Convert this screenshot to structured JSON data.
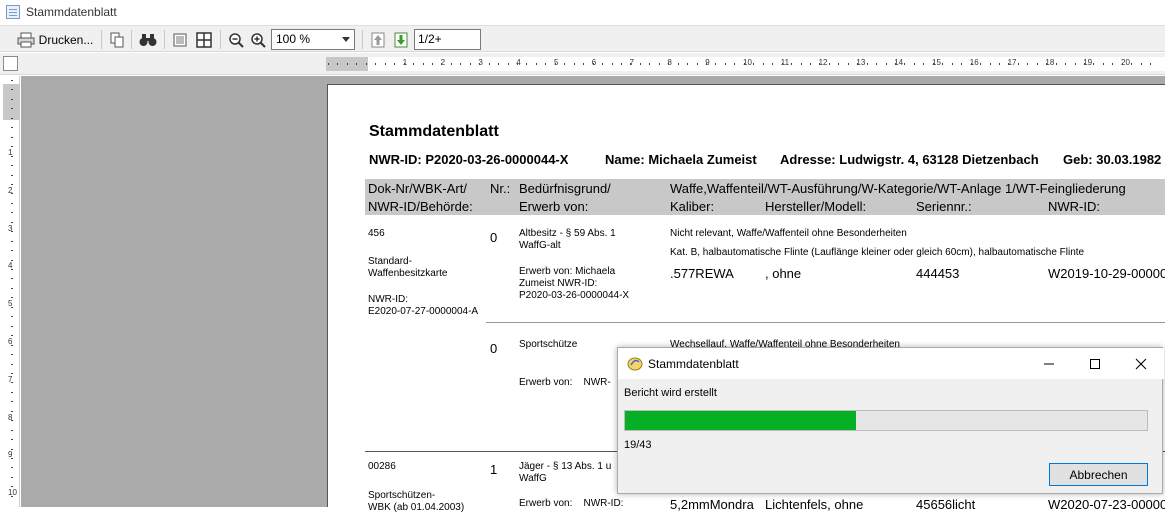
{
  "window": {
    "title": "Stammdatenblatt"
  },
  "toolbar": {
    "print_label": "Drucken...",
    "zoom_value": "100 %",
    "page_value": "1/2+"
  },
  "ruler": {
    "h_numbers": [
      "1",
      "2",
      "3",
      "4",
      "5",
      "6",
      "7",
      "8",
      "9",
      "10",
      "11",
      "12",
      "13",
      "14",
      "15",
      "16",
      "17",
      "18",
      "19",
      "20",
      "21"
    ],
    "v_numbers": [
      "1",
      "2",
      "3",
      "4",
      "5",
      "6",
      "7",
      "8",
      "9",
      "10"
    ]
  },
  "report": {
    "title": "Stammdatenblatt",
    "nwr_id": "NWR-ID: P2020-03-26-0000044-X",
    "name": "Name: Michaela Zumeist",
    "address": "Adresse: Ludwigstr. 4, 63128 Dietzenbach",
    "birth": "Geb: 30.03.1982",
    "headers": {
      "dok_nr": "Dok-Nr/WBK-Art/",
      "nwr_behoerde": "NWR-ID/Behörde:",
      "nr": "Nr.:",
      "beduerfnis": "Bedürfnisgrund/",
      "erwerb": "Erwerb von:",
      "waffe": "Waffe,Waffenteil/WT-Ausführung/W-Kategorie/WT-Anlage 1/WT-Feingliederung",
      "kaliber": "Kaliber:",
      "hersteller": "Hersteller/Modell:",
      "seriennr": "Seriennr.:",
      "nwr_id": "NWR-ID:"
    },
    "rows": [
      {
        "dok_nr": "456",
        "wbk_art": "Standard-\nWaffenbesitzkarte",
        "nwr_label": "NWR-ID:",
        "nwr_value": "E2020-07-27-0000004-A",
        "items": [
          {
            "nr": "0",
            "grund": "Altbesitz - § 59 Abs. 1\nWaffG-alt",
            "erwerb": "Erwerb von: Michaela\nZumeist NWR-ID:\nP2020-03-26-0000044-X",
            "waffe_line1": "Nicht relevant, Waffe/Waffenteil ohne Besonderheiten",
            "waffe_line2": "Kat. B, halbautomatische Flinte (Lauflänge kleiner oder gleich 60cm), halbautomatische Flinte",
            "kaliber": ".577REWA",
            "hersteller": ", ohne",
            "seriennr": "444453",
            "nwr_id": "W2019-10-29-00000"
          },
          {
            "nr": "0",
            "grund": "Sportschütze",
            "erwerb": "Erwerb von:    NWR-",
            "waffe_line1": "Wechsellauf, Waffe/Waffenteil ohne Besonderheiten"
          }
        ]
      },
      {
        "dok_nr": "00286",
        "wbk_art": "Sportschützen-\nWBK (ab 01.04.2003)",
        "items": [
          {
            "nr": "1",
            "grund": "Jäger - § 13 Abs. 1 u\nWaffG",
            "erwerb": "Erwerb von:    NWR-ID:",
            "kaliber": "5,2mmMondra",
            "hersteller": "Lichtenfels, ohne",
            "seriennr": "45656licht",
            "nwr_id": "W2020-07-23-00000"
          }
        ]
      }
    ]
  },
  "dialog": {
    "title": "Stammdatenblatt",
    "message": "Bericht wird erstellt",
    "progress_text": "19/43",
    "progress_fraction": 0.442,
    "cancel_label": "Abbrechen"
  },
  "colors": {
    "progress_fill": "#06b025",
    "header_band": "#c8c8c8",
    "workspace": "#aaaaaa"
  }
}
